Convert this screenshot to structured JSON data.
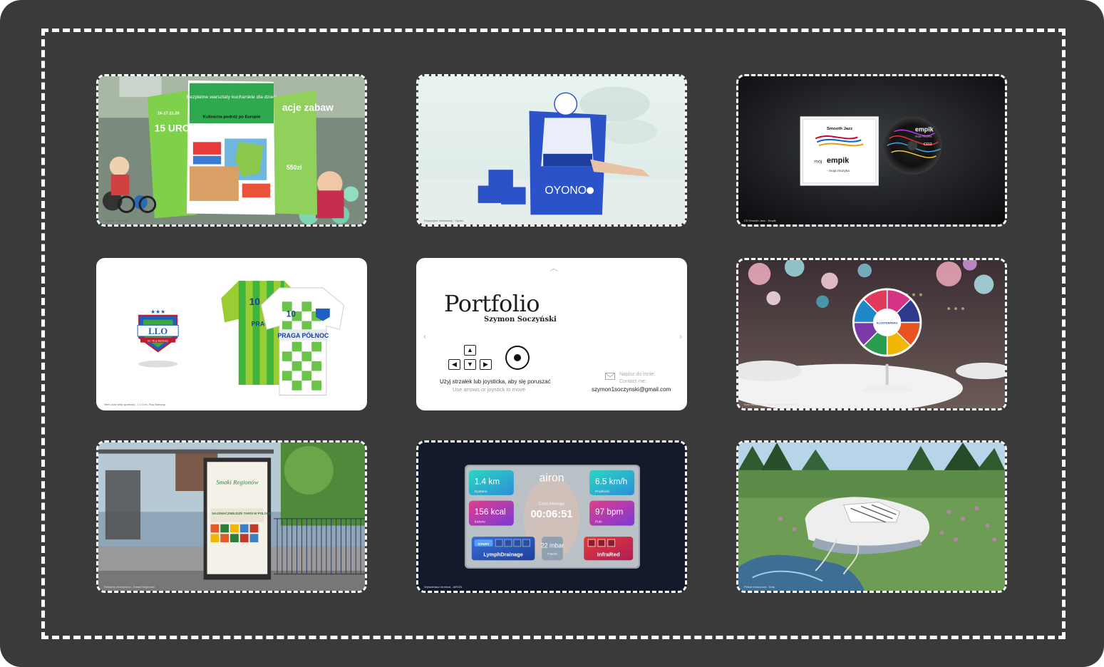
{
  "tiles": {
    "t1": {
      "caption": "Plakaty - Inco Play",
      "poster_title": "Bezpłatne warsztaty kucharskie dla dzieci",
      "poster_subtitle": "Kulinarna podróż po Europie",
      "date_badge": "16-17.11.20",
      "big_text": "15 URO",
      "price": "550zł",
      "right_text": "acje zabaw"
    },
    "t2": {
      "caption": "Ekspozytor reklamowy - Oyono",
      "brand": "OYONO"
    },
    "t3": {
      "caption": "CD Smooth Jazz - Empik",
      "album": "Smooth Jazz",
      "brand": "empik",
      "brand_prefix": "mój",
      "tagline": "- moja muzyka",
      "disc_label": "CD2",
      "disc_sub": "moja muzyka"
    },
    "t4": {
      "caption": "Herb oraz strój sportowy - L LO im. Ruy Barbosy",
      "crest_text": "LLO",
      "crest_sub": "im. Ruy Barbosy",
      "jersey_number": "10",
      "jersey_text": "PRAGA PÓŁNOC",
      "jersey_text_back": "PRAGA"
    },
    "t5": {
      "title": "Portfolio",
      "name": "Szymon Soczyński",
      "hint_pl": "Użyj strzałek lub joysticka, aby się poruszać",
      "hint_en": "Use arrows or joystick to move",
      "contact_pl": "Napisz do mnie:",
      "contact_en": "Contact me:",
      "email": "szymon1soczynski@gmail.com",
      "arrows": {
        "up": "▲",
        "down": "▼",
        "left": "◀",
        "right": "▶"
      },
      "nav": {
        "up": "︿",
        "left": "‹",
        "right": "›"
      }
    },
    "t6": {
      "caption": "Koło reklamowe - Restauracja Warszawa",
      "brand": "KLOSTERFRAU",
      "wheel_colors": [
        "#d63384",
        "#2e3a8c",
        "#e8531f",
        "#f2b705",
        "#2a9d4f",
        "#7a3aa8",
        "#1e88c8",
        "#e23a5a"
      ]
    },
    "t7": {
      "caption": "Reklama zewnętrzna - Smaki Regionów",
      "poster_title": "Smaki Regionów",
      "poster_sub": "NAJSMACZNIEJSZE TARGI W POLSCE"
    },
    "t8": {
      "caption": "Wyświetlacz terminal - AIRON",
      "brand": "airon",
      "distance": "1.4 km",
      "distance_label": "Dystans",
      "speed": "6.5 km/h",
      "speed_label": "Prędkość",
      "kcal": "156 kcal",
      "kcal_label": "Kalorie",
      "bpm": "97 bpm",
      "bpm_label": "Puls",
      "time_label": "Czas treningu",
      "time": "00:06:51",
      "start": "START",
      "lymph": "LymphDrainage",
      "pressure": "22 mbar",
      "pressure_label": "Podcisk",
      "infrared": "InfraRed"
    },
    "t9": {
      "caption": "Plakat reklamowy - Buty"
    }
  }
}
